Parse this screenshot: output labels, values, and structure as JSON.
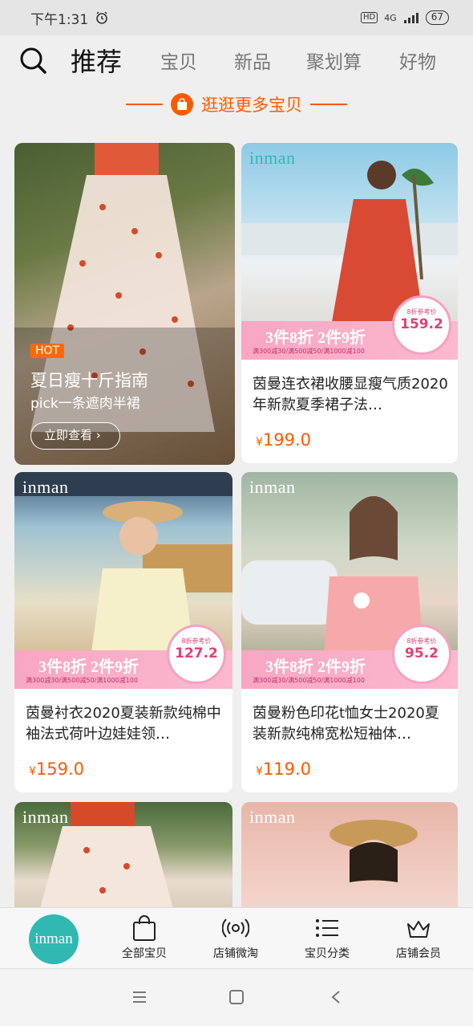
{
  "status": {
    "time": "下午1:31",
    "battery": "67",
    "hd": "HD",
    "net": "4G"
  },
  "top_tabs": [
    {
      "label": "推荐"
    },
    {
      "label": "宝贝"
    },
    {
      "label": "新品"
    },
    {
      "label": "聚划算"
    },
    {
      "label": "好物"
    }
  ],
  "more_link": "逛逛更多宝贝",
  "hero": {
    "hot": "HOT",
    "title": "夏日瘦十斤指南",
    "subtitle": "pick一条遮肉半裙",
    "button": "立即查看"
  },
  "brand": "inman",
  "products": [
    {
      "title": "茵曼连衣裙收腰显瘦气质2020年新款夏季裙子法…",
      "price": "199.0",
      "promo": "3件8折 2件9折",
      "promo_small": "满300减30/满500减50/满1000减100",
      "ref_label": "8折参考价",
      "ref_price": "159.2"
    },
    {
      "title": "茵曼衬衣2020夏装新款纯棉中袖法式荷叶边娃娃领…",
      "price": "159.0",
      "promo": "3件8折 2件9折",
      "promo_small": "满300减30/满500减50/满1000减100",
      "ref_label": "8折参考价",
      "ref_price": "127.2"
    },
    {
      "title": "茵曼粉色印花t恤女士2020夏装新款纯棉宽松短袖体…",
      "price": "119.0",
      "promo": "3件8折 2件9折",
      "promo_small": "满300减30/满500减50/满1000减100",
      "ref_label": "8折参考价",
      "ref_price": "95.2"
    }
  ],
  "currency": "¥",
  "bottom_nav": [
    {
      "label": "全部宝贝"
    },
    {
      "label": "店铺微淘"
    },
    {
      "label": "宝贝分类"
    },
    {
      "label": "店铺会员"
    }
  ]
}
